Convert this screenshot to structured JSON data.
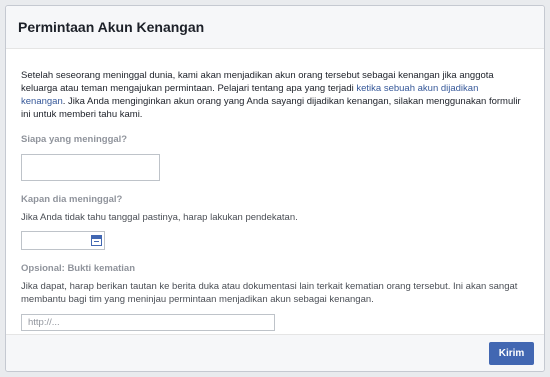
{
  "dialog": {
    "title": "Permintaan Akun Kenangan"
  },
  "intro": {
    "text_before_link": "Setelah seseorang meninggal dunia, kami akan menjadikan akun orang tersebut sebagai kenangan jika anggota keluarga atau teman mengajukan permintaan. Pelajari tentang apa yang terjadi ",
    "link_text": "ketika sebuah akun dijadikan kenangan",
    "text_after_link": ". Jika Anda menginginkan akun orang yang Anda sayangi dijadikan kenangan, silakan menggunakan formulir ini untuk memberi tahu kami."
  },
  "who": {
    "label": "Siapa yang meninggal?",
    "value": ""
  },
  "when": {
    "label": "Kapan dia meninggal?",
    "help": "Jika Anda tidak tahu tanggal pastinya, harap lakukan pendekatan.",
    "value": ""
  },
  "proof": {
    "label": "Opsional: Bukti kematian",
    "help": "Jika dapat, harap berikan tautan ke berita duka atau dokumentasi lain terkait kematian orang tersebut. Ini akan sangat membantu bagi tim yang meninjau permintaan menjadikan akun sebagai kenangan.",
    "placeholder": "http://...",
    "value": ""
  },
  "footer": {
    "submit_label": "Kirim"
  },
  "colors": {
    "accent": "#4267b2",
    "link": "#365899"
  },
  "icons": {
    "date": "calendar-icon"
  }
}
